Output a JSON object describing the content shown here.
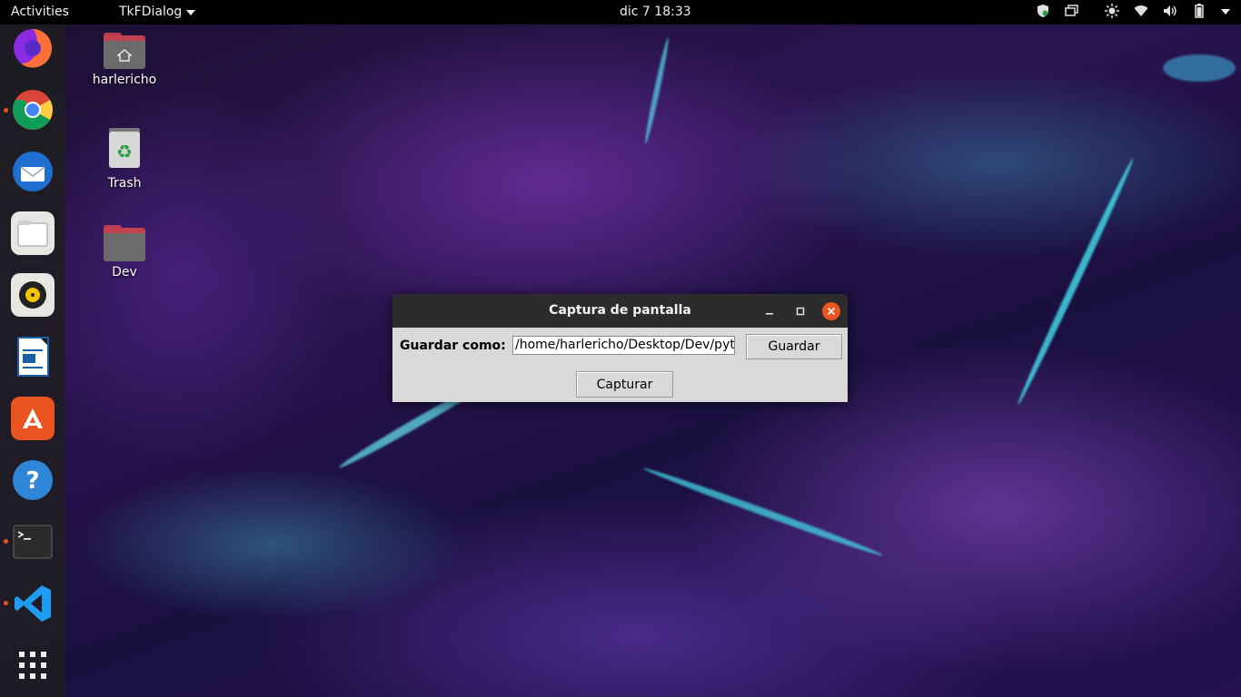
{
  "topbar": {
    "activities": "Activities",
    "app_name": "TkFDialog",
    "clock": "dic 7  18:33"
  },
  "dock": {
    "items": [
      "firefox-icon",
      "chrome-icon",
      "thunderbird-icon",
      "files-icon",
      "rhythmbox-icon",
      "writer-icon",
      "software-icon",
      "help-icon",
      "terminal-icon",
      "vscode-icon",
      "app-grid-icon"
    ]
  },
  "desktop": {
    "icons": [
      {
        "label": "harlericho"
      },
      {
        "label": "Trash"
      },
      {
        "label": "Dev"
      }
    ]
  },
  "dialog": {
    "title": "Captura de pantalla",
    "save_as_label": "Guardar como:",
    "path_value": "/home/harlericho/Desktop/Dev/pythor",
    "save_button": "Guardar",
    "capture_button": "Capturar"
  },
  "colors": {
    "accent": "#e95420",
    "titlebar": "#2c2c2c",
    "dialog_bg": "#d9d9d9"
  }
}
